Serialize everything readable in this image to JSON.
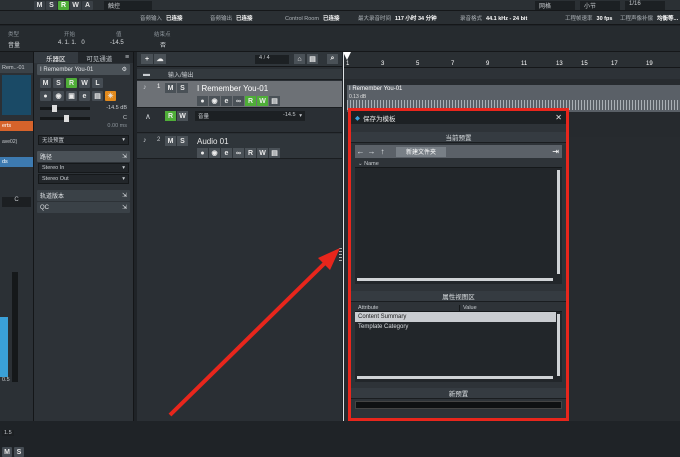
{
  "toolbar": {
    "buttons": [
      "M",
      "S",
      "R",
      "W",
      "A"
    ],
    "dropdown_value": "触控",
    "right_dropdown": "网格",
    "right_dropdown2": "小节",
    "counter": "1/16"
  },
  "status": {
    "audio_input": {
      "label": "音频输入",
      "value": "已连接"
    },
    "audio_output": {
      "label": "音频输出",
      "value": "已连接"
    },
    "control_room": {
      "label": "Control Room",
      "value": "已连接"
    },
    "max_record": {
      "label": "最大录音时间",
      "value": "117 小时 34 分钟"
    },
    "record_format": {
      "label": "录音格式",
      "value": "44.1 kHz - 24 bit"
    },
    "frame_rate": {
      "label": "工程帧速率",
      "value": "30 fps"
    },
    "pan_law": {
      "label": "工程声像补偿",
      "value": "均衡等..."
    }
  },
  "infoline": {
    "type": {
      "label": "类型",
      "value": "音量"
    },
    "start": {
      "label": "开始",
      "value": "4. 1. 1.   0"
    },
    "val": {
      "label": "值",
      "value": "-14.5"
    },
    "end": {
      "label": "结束点",
      "value": "否"
    }
  },
  "leftstrip": {
    "label": "Rem..-01",
    "labels": [
      "erts",
      "ds"
    ],
    "value": "ave02)",
    "fader": "C",
    "num1": "0.5",
    "num2": "1.5"
  },
  "inspector": {
    "tabs": [
      "",
      ""
    ],
    "tab_active": "乐器区",
    "tab_other": "可见通道",
    "track_name": "I Remember You-01",
    "volume": "-14.5 dB",
    "pan": "C",
    "zero": "0.00 ms",
    "no_preset": "无设预置",
    "routing_label": "路径",
    "input": "Stereo In",
    "output": "Stereo Out",
    "channel_text": "轨道版本",
    "qc": "QC"
  },
  "tracklist": {
    "counter": "4 / 4",
    "folder": "输入/输出",
    "tracks": [
      {
        "num": "1",
        "name": "I Remember You-01",
        "sub": "音量",
        "value": "-14.5"
      },
      {
        "num": "2",
        "name": "Audio 01"
      }
    ]
  },
  "ruler": {
    "marks": [
      "1",
      "3",
      "5",
      "7",
      "9",
      "11",
      "13",
      "15",
      "17",
      "19"
    ]
  },
  "clip": {
    "name": "I Remember You-01",
    "sub": "0.13 dB"
  },
  "dialog": {
    "title": "保存为模板",
    "sec1": "当前预置",
    "new_folder": "新建文件夹",
    "name_col": "Name",
    "sec2": "属性视图区",
    "attr_col": "Attribute",
    "value_col": "Value",
    "rows": [
      "Content Summary",
      "Template Category"
    ],
    "sec3": "新预置"
  },
  "colors": {
    "accent": "#4fae38",
    "highlight": "#e8261c",
    "solo": "#e38a1c"
  }
}
